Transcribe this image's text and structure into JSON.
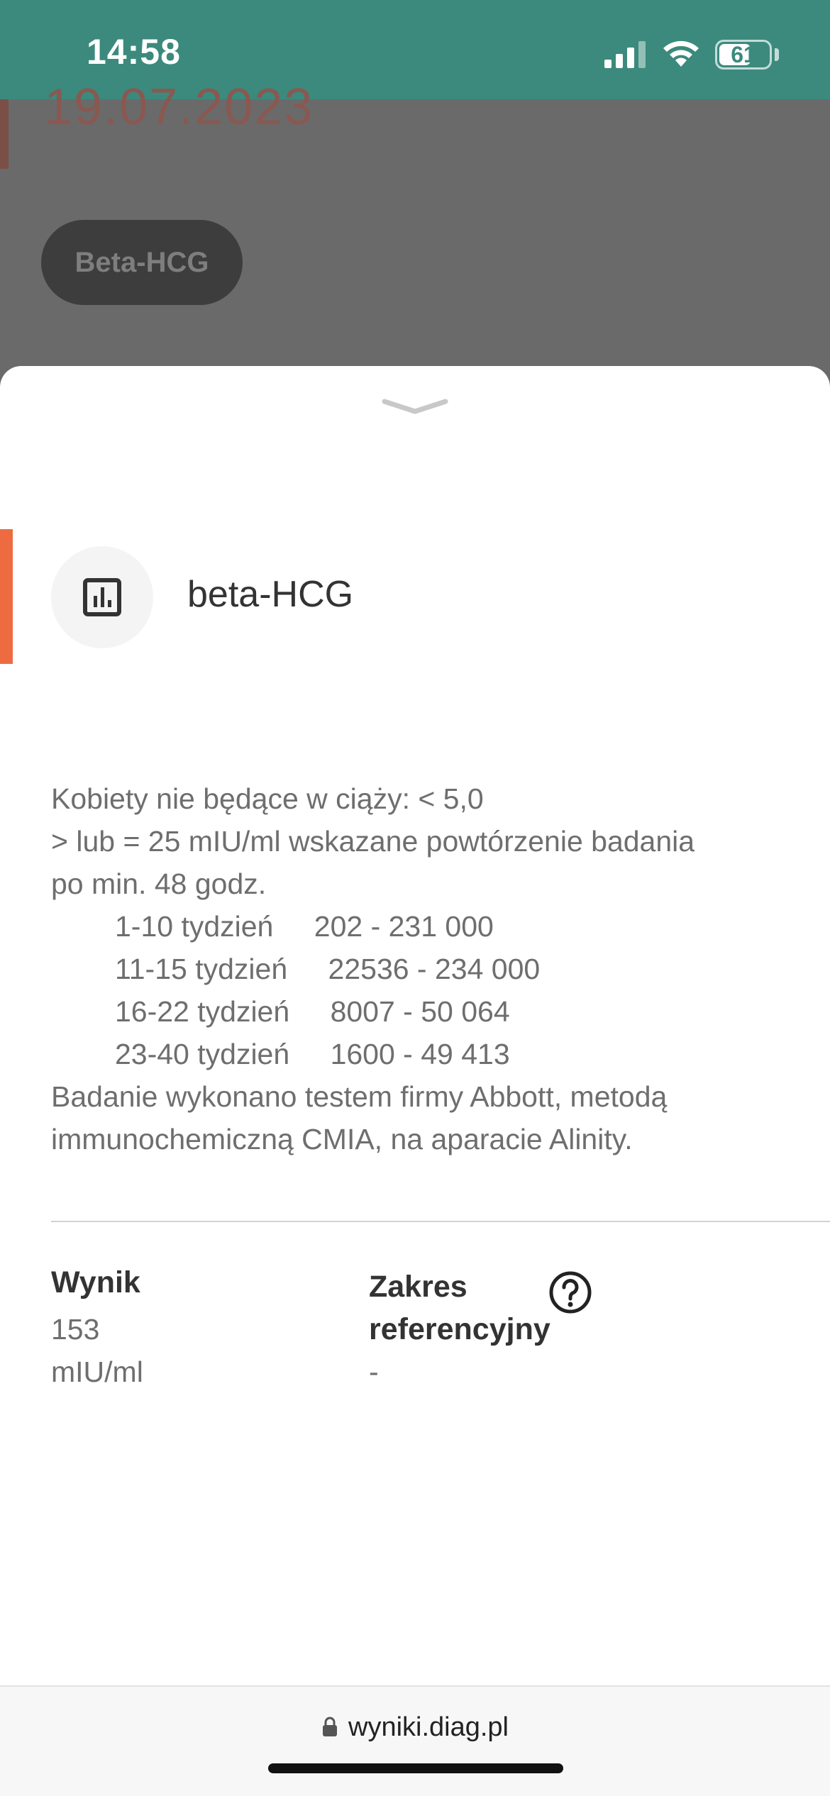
{
  "status_bar": {
    "time": "14:58",
    "battery_percent": "61",
    "icons": [
      "signal-icon",
      "wifi-icon",
      "battery-icon"
    ],
    "signal_bars_active": 3,
    "signal_bars_total": 4
  },
  "background_page": {
    "date": "19.07.2023",
    "chip_label": "Beta-HCG"
  },
  "sheet": {
    "icon": "bar-chart-icon",
    "title": "beta-HCG",
    "description_lines": [
      "Kobiety nie będące w ciąży: < 5,0",
      "> lub = 25 mIU/ml wskazane powtórzenie badania",
      "po min. 48 godz."
    ],
    "ranges": [
      {
        "week": "1-10 tydzień",
        "value": "202 - 231 000"
      },
      {
        "week": "11-15 tydzień",
        "value": "22536 - 234 000"
      },
      {
        "week": "16-22 tydzień",
        "value": "8007 - 50 064"
      },
      {
        "week": "23-40 tydzień",
        "value": "1600 - 49 413"
      }
    ],
    "method_lines": [
      "Badanie wykonano testem firmy Abbott, metodą",
      "immunochemiczną CMIA, na aparacie Alinity."
    ],
    "result": {
      "label": "Wynik",
      "value": "153",
      "unit": "mIU/ml"
    },
    "reference": {
      "label": "Zakres referencyjny",
      "value": "-",
      "help_icon": "question-circle-icon"
    }
  },
  "browser": {
    "url": "wyniki.diag.pl",
    "icon": "lock-icon"
  },
  "colors": {
    "status_bar": "#3b8a7d",
    "accent": "#ee6b42",
    "overlay": "#6a6a6a"
  }
}
